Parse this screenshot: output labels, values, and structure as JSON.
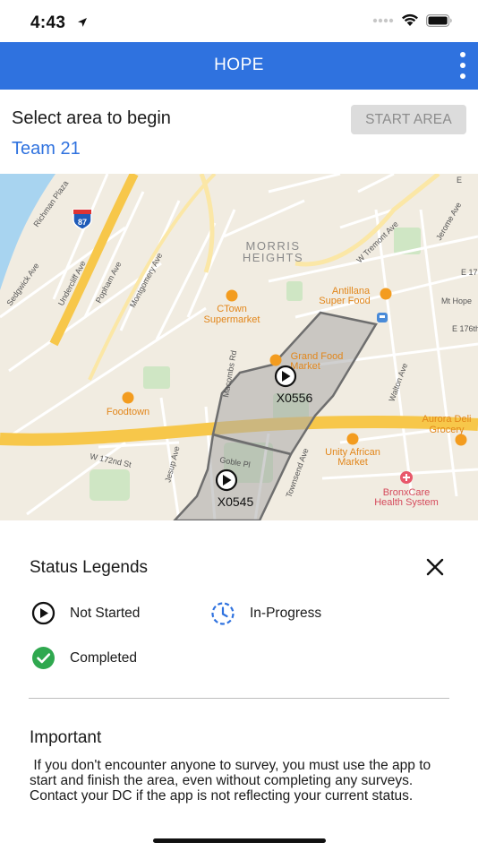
{
  "status_bar": {
    "time": "4:43"
  },
  "header": {
    "title": "HOPE"
  },
  "top": {
    "prompt": "Select area to begin",
    "start_label": "START AREA",
    "team": "Team 21"
  },
  "map": {
    "neighborhood": [
      "MORRIS",
      "HEIGHTS"
    ],
    "streets": {
      "richman": "Richman Plaza",
      "sedgwick": "Sedgwick Ave",
      "undercliff": "Undercliff Ave",
      "popham": "Popham Ave",
      "montgomery": "Montgomery Ave",
      "macombs": "Macombs Rd",
      "jesup": "Jesup Ave",
      "w172": "W 172nd St",
      "goble": "Goble Pl",
      "townsend": "Townsend Ave",
      "walton": "Walton Ave",
      "tremont": "W Tremont Ave",
      "jerome": "Jerome Ave",
      "e176": "E 176th",
      "mthope": "Mt Hope",
      "e17": "E 17",
      "e": "E"
    },
    "interstate": "87",
    "pois": [
      {
        "lines": [
          "CTown",
          "Supermarket"
        ]
      },
      {
        "lines": [
          "Antillana",
          "Super Food"
        ]
      },
      {
        "lines": [
          "Grand Food",
          "Market"
        ]
      },
      {
        "lines": [
          "Foodtown"
        ]
      },
      {
        "lines": [
          "Aurora Deli",
          "Grocery"
        ]
      },
      {
        "lines": [
          "Unity African",
          "Market"
        ]
      },
      {
        "lines": [
          "BronxCare",
          "Health System"
        ]
      }
    ],
    "areas": [
      {
        "code": "X0556"
      },
      {
        "code": "X0545"
      }
    ],
    "colors": {
      "land": "#f1ece1",
      "water": "#a8d4f0",
      "highway": "#f7c74a",
      "park": "#cfe6c4",
      "area_fill": "#a9a9a9",
      "area_stroke": "#6e6e6e",
      "poi": "#f39c1f"
    }
  },
  "legend": {
    "title": "Status Legends",
    "items": [
      {
        "label": "Not Started",
        "icon": "play-circle-icon"
      },
      {
        "label": "In-Progress",
        "icon": "clock-dashed-icon"
      },
      {
        "label": "Completed",
        "icon": "check-circle-icon"
      }
    ]
  },
  "important": {
    "title": "Important",
    "body": " If you don't encounter anyone to survey, you must use the app to start and finish the area, even without completing any surveys. Contact your DC if the app is not reflecting your current status."
  }
}
